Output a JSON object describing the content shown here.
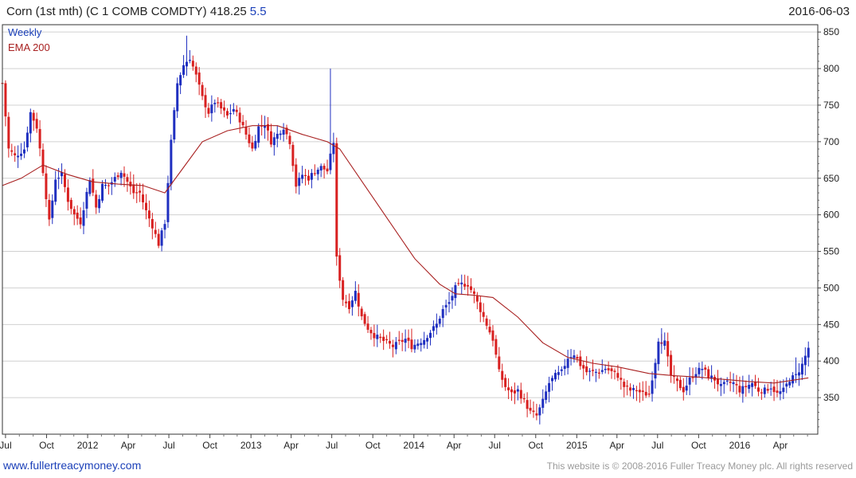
{
  "header": {
    "title": "Corn (1st mth) (C 1 COMB COMDTY) 418.25",
    "change": "5.5",
    "date": "2016-06-03"
  },
  "footer": {
    "site": "www.fullertreacymoney.com",
    "copyright": "This website is © 2008-2016 Fuller Treacy Money plc. All rights reserved"
  },
  "colors": {
    "up": "#1f2fc0",
    "down": "#d82020",
    "ema": "#a82020",
    "grid": "#d0d0d0",
    "label_blue": "#1a3fb8"
  },
  "chart_data": {
    "type": "candlestick",
    "legend": [
      "Weekly",
      "EMA 200"
    ],
    "ylim": [
      300,
      860
    ],
    "yticks": [
      350,
      400,
      450,
      500,
      550,
      600,
      650,
      700,
      750,
      800,
      850
    ],
    "xlim": [
      "2011-06-24",
      "2016-06-24"
    ],
    "xticks": [
      {
        "date": "2011-07-01",
        "label": "Jul"
      },
      {
        "date": "2011-10-01",
        "label": "Oct"
      },
      {
        "date": "2012-01-01",
        "label": "2012"
      },
      {
        "date": "2012-04-01",
        "label": "Apr"
      },
      {
        "date": "2012-07-01",
        "label": "Jul"
      },
      {
        "date": "2012-10-01",
        "label": "Oct"
      },
      {
        "date": "2013-01-01",
        "label": "2013"
      },
      {
        "date": "2013-04-01",
        "label": "Apr"
      },
      {
        "date": "2013-07-01",
        "label": "Jul"
      },
      {
        "date": "2013-10-01",
        "label": "Oct"
      },
      {
        "date": "2014-01-01",
        "label": "2014"
      },
      {
        "date": "2014-04-01",
        "label": "Apr"
      },
      {
        "date": "2014-07-01",
        "label": "Jul"
      },
      {
        "date": "2014-10-01",
        "label": "Oct"
      },
      {
        "date": "2015-01-01",
        "label": "2015"
      },
      {
        "date": "2015-04-01",
        "label": "Apr"
      },
      {
        "date": "2015-07-01",
        "label": "Jul"
      },
      {
        "date": "2015-10-01",
        "label": "Oct"
      },
      {
        "date": "2016-01-01",
        "label": "2016"
      },
      {
        "date": "2016-04-01",
        "label": "Apr"
      }
    ],
    "close_anchors": [
      [
        "2011-06-24",
        780
      ],
      [
        "2011-07-08",
        690
      ],
      [
        "2011-07-22",
        680
      ],
      [
        "2011-08-12",
        690
      ],
      [
        "2011-08-26",
        740
      ],
      [
        "2011-09-09",
        720
      ],
      [
        "2011-09-23",
        660
      ],
      [
        "2011-10-07",
        590
      ],
      [
        "2011-10-21",
        650
      ],
      [
        "2011-11-04",
        655
      ],
      [
        "2011-11-18",
        620
      ],
      [
        "2011-12-02",
        600
      ],
      [
        "2011-12-16",
        590
      ],
      [
        "2012-01-06",
        650
      ],
      [
        "2012-01-20",
        610
      ],
      [
        "2012-02-03",
        640
      ],
      [
        "2012-02-17",
        640
      ],
      [
        "2012-03-02",
        650
      ],
      [
        "2012-03-16",
        660
      ],
      [
        "2012-03-30",
        645
      ],
      [
        "2012-04-13",
        630
      ],
      [
        "2012-04-27",
        630
      ],
      [
        "2012-05-11",
        605
      ],
      [
        "2012-05-25",
        585
      ],
      [
        "2012-06-08",
        560
      ],
      [
        "2012-06-22",
        590
      ],
      [
        "2012-07-06",
        700
      ],
      [
        "2012-07-20",
        780
      ],
      [
        "2012-08-03",
        805
      ],
      [
        "2012-08-17",
        815
      ],
      [
        "2012-08-31",
        790
      ],
      [
        "2012-09-14",
        760
      ],
      [
        "2012-09-28",
        740
      ],
      [
        "2012-10-12",
        755
      ],
      [
        "2012-10-26",
        745
      ],
      [
        "2012-11-09",
        735
      ],
      [
        "2012-11-23",
        745
      ],
      [
        "2012-12-07",
        730
      ],
      [
        "2012-12-21",
        710
      ],
      [
        "2013-01-04",
        690
      ],
      [
        "2013-01-18",
        720
      ],
      [
        "2013-02-01",
        725
      ],
      [
        "2013-02-15",
        700
      ],
      [
        "2013-03-01",
        710
      ],
      [
        "2013-03-15",
        720
      ],
      [
        "2013-03-29",
        700
      ],
      [
        "2013-04-12",
        640
      ],
      [
        "2013-04-26",
        655
      ],
      [
        "2013-05-10",
        650
      ],
      [
        "2013-05-24",
        660
      ],
      [
        "2013-06-07",
        665
      ],
      [
        "2013-06-21",
        660
      ],
      [
        "2013-07-05",
        700
      ],
      [
        "2013-07-12",
        540
      ],
      [
        "2013-07-26",
        485
      ],
      [
        "2013-08-09",
        475
      ],
      [
        "2013-08-23",
        495
      ],
      [
        "2013-09-06",
        460
      ],
      [
        "2013-09-20",
        445
      ],
      [
        "2013-10-04",
        435
      ],
      [
        "2013-10-18",
        430
      ],
      [
        "2013-11-01",
        425
      ],
      [
        "2013-11-15",
        420
      ],
      [
        "2013-11-29",
        425
      ],
      [
        "2013-12-13",
        430
      ],
      [
        "2013-12-27",
        420
      ],
      [
        "2014-01-10",
        425
      ],
      [
        "2014-01-24",
        430
      ],
      [
        "2014-02-07",
        440
      ],
      [
        "2014-02-21",
        450
      ],
      [
        "2014-03-07",
        470
      ],
      [
        "2014-03-21",
        480
      ],
      [
        "2014-04-04",
        500
      ],
      [
        "2014-04-18",
        505
      ],
      [
        "2014-05-02",
        505
      ],
      [
        "2014-05-16",
        490
      ],
      [
        "2014-05-30",
        470
      ],
      [
        "2014-06-13",
        450
      ],
      [
        "2014-06-27",
        430
      ],
      [
        "2014-07-11",
        385
      ],
      [
        "2014-07-25",
        365
      ],
      [
        "2014-08-08",
        355
      ],
      [
        "2014-08-22",
        360
      ],
      [
        "2014-09-05",
        345
      ],
      [
        "2014-09-19",
        330
      ],
      [
        "2014-10-03",
        325
      ],
      [
        "2014-10-17",
        345
      ],
      [
        "2014-10-31",
        370
      ],
      [
        "2014-11-14",
        380
      ],
      [
        "2014-11-28",
        385
      ],
      [
        "2014-12-12",
        405
      ],
      [
        "2014-12-26",
        410
      ],
      [
        "2015-01-09",
        395
      ],
      [
        "2015-01-23",
        385
      ],
      [
        "2015-02-06",
        385
      ],
      [
        "2015-02-20",
        385
      ],
      [
        "2015-03-06",
        390
      ],
      [
        "2015-03-20",
        385
      ],
      [
        "2015-04-03",
        380
      ],
      [
        "2015-04-17",
        365
      ],
      [
        "2015-05-01",
        360
      ],
      [
        "2015-05-15",
        360
      ],
      [
        "2015-05-29",
        355
      ],
      [
        "2015-06-12",
        355
      ],
      [
        "2015-06-26",
        400
      ],
      [
        "2015-07-03",
        430
      ],
      [
        "2015-07-17",
        425
      ],
      [
        "2015-07-31",
        380
      ],
      [
        "2015-08-14",
        370
      ],
      [
        "2015-08-28",
        360
      ],
      [
        "2015-09-11",
        375
      ],
      [
        "2015-09-25",
        385
      ],
      [
        "2015-10-09",
        390
      ],
      [
        "2015-10-23",
        380
      ],
      [
        "2015-11-06",
        375
      ],
      [
        "2015-11-20",
        365
      ],
      [
        "2015-12-04",
        370
      ],
      [
        "2015-12-18",
        370
      ],
      [
        "2016-01-01",
        360
      ],
      [
        "2016-01-15",
        365
      ],
      [
        "2016-01-29",
        370
      ],
      [
        "2016-02-12",
        360
      ],
      [
        "2016-02-26",
        360
      ],
      [
        "2016-03-11",
        365
      ],
      [
        "2016-03-25",
        355
      ],
      [
        "2016-04-08",
        360
      ],
      [
        "2016-04-22",
        375
      ],
      [
        "2016-05-06",
        380
      ],
      [
        "2016-05-20",
        395
      ],
      [
        "2016-06-03",
        418.25
      ]
    ],
    "ema200_anchors": [
      [
        "2011-06-24",
        640
      ],
      [
        "2011-08-05",
        650
      ],
      [
        "2011-09-23",
        668
      ],
      [
        "2011-11-18",
        655
      ],
      [
        "2012-01-13",
        645
      ],
      [
        "2012-03-09",
        642
      ],
      [
        "2012-05-04",
        640
      ],
      [
        "2012-06-22",
        630
      ],
      [
        "2012-08-03",
        665
      ],
      [
        "2012-09-14",
        700
      ],
      [
        "2012-11-09",
        715
      ],
      [
        "2013-01-04",
        722
      ],
      [
        "2013-03-01",
        722
      ],
      [
        "2013-04-26",
        710
      ],
      [
        "2013-06-21",
        700
      ],
      [
        "2013-07-19",
        690
      ],
      [
        "2013-09-13",
        640
      ],
      [
        "2013-11-08",
        590
      ],
      [
        "2014-01-03",
        540
      ],
      [
        "2014-02-28",
        505
      ],
      [
        "2014-04-04",
        492
      ],
      [
        "2014-05-16",
        490
      ],
      [
        "2014-06-27",
        487
      ],
      [
        "2014-08-22",
        460
      ],
      [
        "2014-10-17",
        425
      ],
      [
        "2014-12-12",
        405
      ],
      [
        "2015-02-06",
        397
      ],
      [
        "2015-04-03",
        392
      ],
      [
        "2015-06-12",
        383
      ],
      [
        "2015-08-07",
        380
      ],
      [
        "2015-10-02",
        378
      ],
      [
        "2015-11-27",
        375
      ],
      [
        "2016-01-22",
        372
      ],
      [
        "2016-03-18",
        370
      ],
      [
        "2016-06-03",
        377
      ]
    ]
  }
}
